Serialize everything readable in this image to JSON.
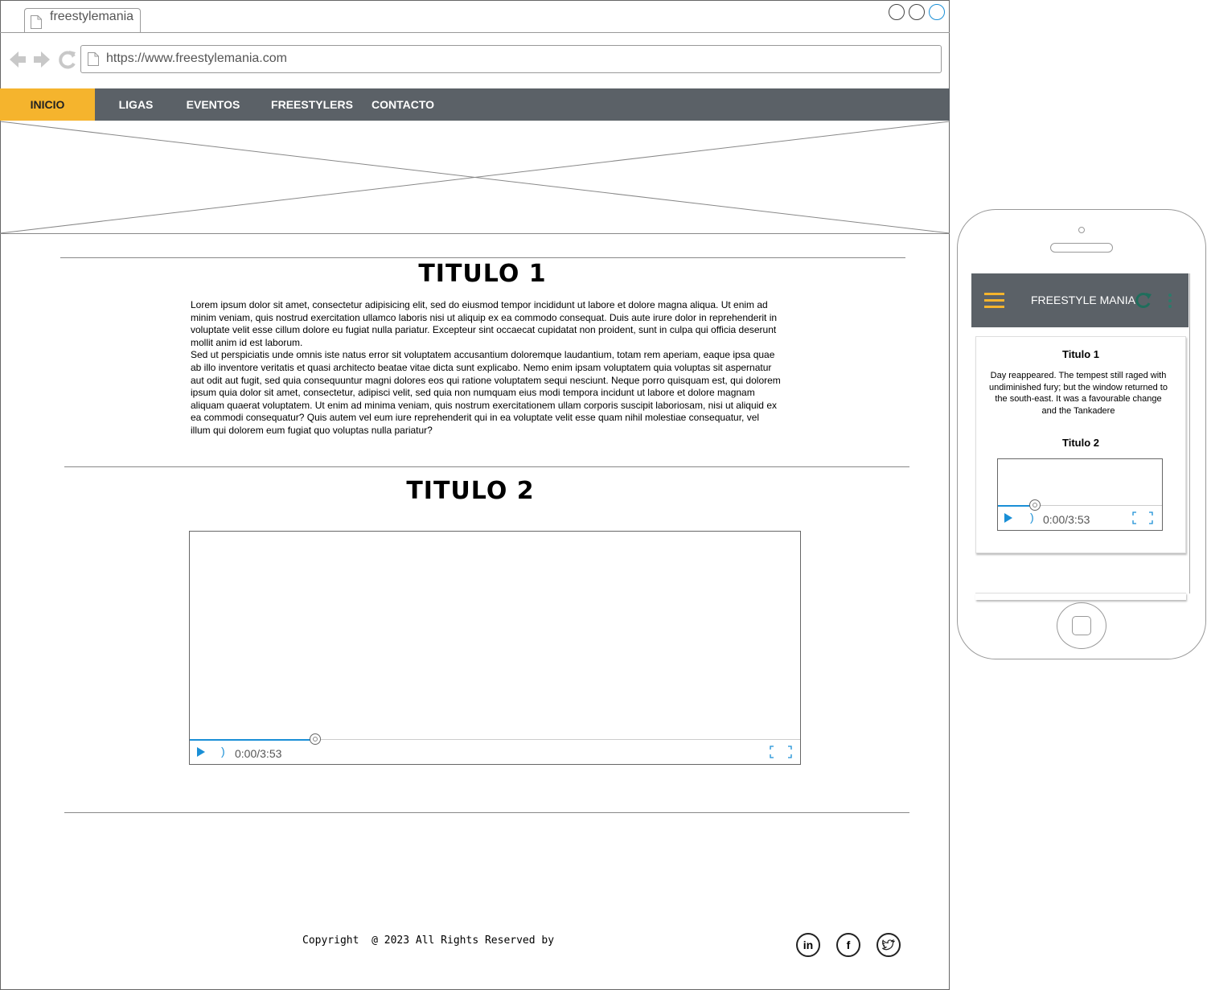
{
  "browser": {
    "tab_title": "freestylemania",
    "url": "https://www.freestylemania.com"
  },
  "nav": {
    "items": [
      {
        "label": "INICIO",
        "active": true
      },
      {
        "label": "LIGAS"
      },
      {
        "label": "EVENTOS"
      },
      {
        "label": "FREESTYLERS"
      },
      {
        "label": "CONTACTO"
      }
    ]
  },
  "colors": {
    "accent": "#f5b42d",
    "navbar": "#5b6167",
    "player": "#1a8fd6"
  },
  "section1": {
    "title": "TITULO 1",
    "paragraph1": "Lorem ipsum dolor sit amet, consectetur adipisicing elit, sed do eiusmod tempor incididunt ut labore et dolore magna aliqua. Ut enim ad minim veniam, quis nostrud exercitation ullamco laboris nisi ut aliquip ex ea commodo consequat. Duis aute irure dolor in reprehenderit in voluptate velit esse cillum dolore eu fugiat nulla pariatur. Excepteur sint occaecat cupidatat non proident, sunt in culpa qui officia deserunt mollit anim id est laborum.",
    "paragraph2": "Sed ut perspiciatis unde omnis iste natus error sit voluptatem accusantium doloremque laudantium, totam rem aperiam, eaque ipsa quae ab illo inventore veritatis et quasi architecto beatae vitae dicta sunt explicabo. Nemo enim ipsam voluptatem quia voluptas sit aspernatur aut odit aut fugit, sed quia consequuntur magni dolores eos qui ratione voluptatem sequi nesciunt. Neque porro quisquam est, qui dolorem ipsum quia dolor sit amet, consectetur, adipisci velit, sed quia non numquam eius modi tempora incidunt ut labore et dolore magnam aliquam quaerat voluptatem. Ut enim ad minima veniam, quis nostrum exercitationem ullam corporis suscipit laboriosam, nisi ut aliquid ex ea commodi consequatur? Quis autem vel eum iure reprehenderit qui in ea voluptate velit esse quam nihil molestiae consequatur, vel illum qui dolorem eum fugiat quo voluptas nulla pariatur?"
  },
  "section2": {
    "title": "TITULO 2",
    "video": {
      "time": "0:00/3:53"
    }
  },
  "footer": {
    "copyright": "Copyright  @ 2023 All Rights Reserved by",
    "social": [
      "linkedin-icon",
      "facebook-icon",
      "twitter-icon"
    ]
  },
  "mobile": {
    "app_title": "FREESTYLE MANIA",
    "heading1": "Titulo 1",
    "text": "Day reappeared. The tempest still raged with undiminished fury; but the window returned to the south-east. It was a favourable change and the Tankadere",
    "heading2": "Titulo 2",
    "video": {
      "time": "0:00/3:53"
    }
  }
}
